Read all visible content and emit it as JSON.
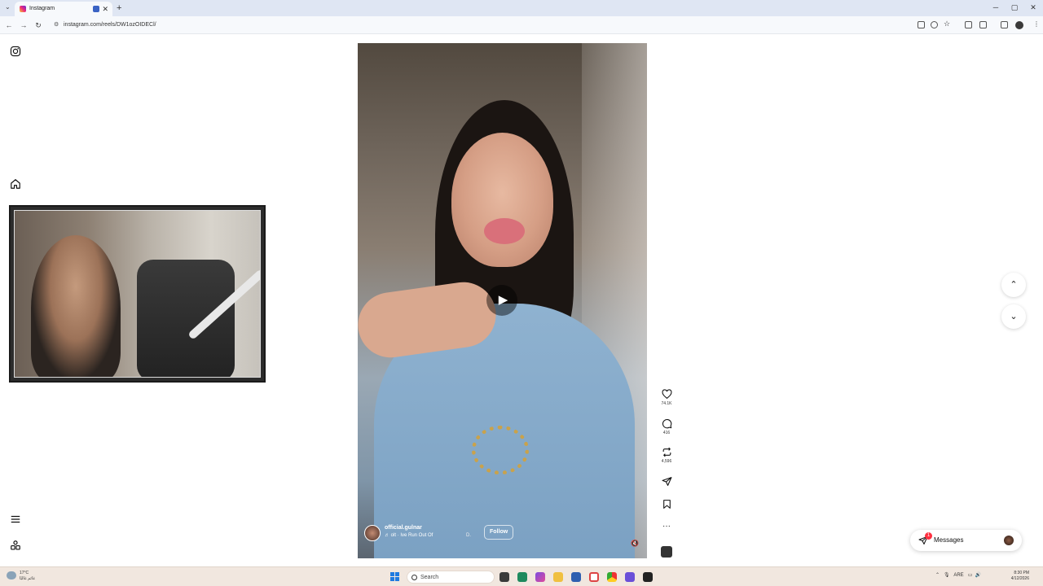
{
  "browser": {
    "tab_title": "Instagram",
    "new_tab": "+",
    "close": "✕",
    "url": "instagram.com/reels/DW1ozOIDECl/",
    "window_controls": {
      "minimize": "─",
      "maximize": "▢",
      "close": "✕"
    },
    "nav": {
      "back": "←",
      "forward": "→",
      "reload": "↻"
    }
  },
  "reel": {
    "play": "▶",
    "username": "official.gulnar",
    "audio": "♬ olt · Ive Run Out Of",
    "more": "D.",
    "follow": "Follow",
    "mute": "🔇"
  },
  "actions": {
    "likes": "74.1K",
    "comments": "416",
    "reposts": "4,596"
  },
  "nav_arrows": {
    "up": "⌃",
    "down": "⌄"
  },
  "messages": {
    "label": "Messages",
    "badge": "1"
  },
  "taskbar": {
    "weather_temp": "17°C",
    "weather_desc": "غائم غالبًا",
    "search": "Search",
    "lang": "ARE",
    "time": "8:30 PM",
    "date": "4/12/2026"
  },
  "colors": {
    "notification": "#ff3040",
    "start": "#1f7ae0"
  }
}
